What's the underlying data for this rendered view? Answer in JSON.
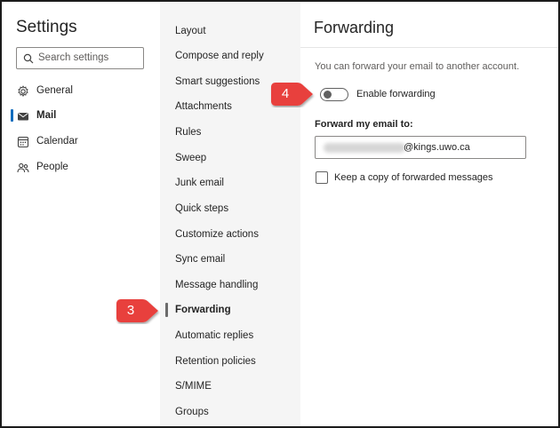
{
  "settings": {
    "title": "Settings",
    "search_placeholder": "Search settings",
    "nav": [
      {
        "label": "General",
        "icon": "gear-icon"
      },
      {
        "label": "Mail",
        "icon": "mail-icon",
        "active": true
      },
      {
        "label": "Calendar",
        "icon": "calendar-icon"
      },
      {
        "label": "People",
        "icon": "people-icon"
      }
    ]
  },
  "mail_menu": [
    "Layout",
    "Compose and reply",
    "Smart suggestions",
    "Attachments",
    "Rules",
    "Sweep",
    "Junk email",
    "Quick steps",
    "Customize actions",
    "Sync email",
    "Message handling",
    "Forwarding",
    "Automatic replies",
    "Retention policies",
    "S/MIME",
    "Groups"
  ],
  "mail_menu_active": "Forwarding",
  "forwarding": {
    "title": "Forwarding",
    "description": "You can forward your email to another account.",
    "enable_label": "Enable forwarding",
    "enable_on": false,
    "forward_to_label": "Forward my email to:",
    "email_domain": "@kings.uwo.ca",
    "keep_copy_label": "Keep a copy of forwarded messages",
    "keep_copy_checked": false
  },
  "annotations": {
    "step3": "3",
    "step4": "4",
    "marker_color": "#e8413c"
  }
}
